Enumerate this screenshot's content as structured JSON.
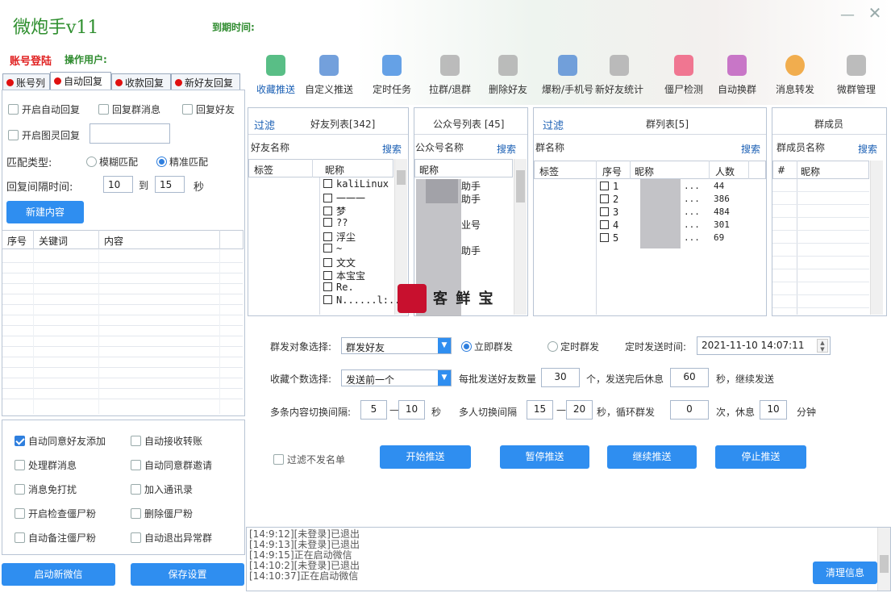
{
  "app": {
    "title": "微炮手v11",
    "expire_label": "到期时间:",
    "login_label": "账号登陆",
    "operator_label": "操作用户:",
    "min_glyph": "—",
    "close_glyph": "✕"
  },
  "toolbar": [
    {
      "label": "收藏推送",
      "icon": "bookmark-star-icon",
      "color": "#3cb371"
    },
    {
      "label": "自定义推送",
      "icon": "send-plane-icon",
      "color": "#5b8fd6"
    },
    {
      "label": "定时任务",
      "icon": "id-card-icon",
      "color": "#4a90e2"
    },
    {
      "label": "拉群/退群",
      "icon": "users-icon",
      "color": "#b0b0b0"
    },
    {
      "label": "删除好友",
      "icon": "remove-user-icon",
      "color": "#b0b0b0"
    },
    {
      "label": "爆粉/手机号",
      "icon": "contact-card-icon",
      "color": "#5b8fd6"
    },
    {
      "label": "新好友统计",
      "icon": "new-user-icon",
      "color": "#b0b0b0"
    },
    {
      "label": "僵尸检测",
      "icon": "zombie-face-icon",
      "color": "#f06080"
    },
    {
      "label": "自动换群",
      "icon": "document-icon",
      "color": "#c060c0"
    },
    {
      "label": "消息转发",
      "icon": "circles-icon",
      "color": "#f0a030"
    },
    {
      "label": "微群管理",
      "icon": "gear-icon",
      "color": "#b0b0b0"
    }
  ],
  "left_tabs": [
    "账号列",
    "自动回复",
    "收款回复",
    "新好友回复"
  ],
  "auto_reply": {
    "enable_auto": "开启自动回复",
    "reply_group": "回复群消息",
    "reply_friend": "回复好友",
    "enable_ghost": "开启图灵回复",
    "ghost_value": "",
    "match_type_label": "匹配类型:",
    "fuzzy": "模糊匹配",
    "exact": "精准匹配",
    "interval_label": "回复间隔时间:",
    "interval_from": "10",
    "to": "到",
    "interval_to": "15",
    "sec": "秒",
    "new_content": "新建内容",
    "columns": [
      "序号",
      "关键词",
      "内容"
    ]
  },
  "options": [
    {
      "label": "自动同意好友添加",
      "checked": true
    },
    {
      "label": "自动接收转账",
      "checked": false
    },
    {
      "label": "处理群消息",
      "checked": false
    },
    {
      "label": "自动同意群邀请",
      "checked": false
    },
    {
      "label": "消息免打扰",
      "checked": false
    },
    {
      "label": "加入通讯录",
      "checked": false
    },
    {
      "label": "开启检查僵尸粉",
      "checked": false
    },
    {
      "label": "删除僵尸粉",
      "checked": false
    },
    {
      "label": "自动备注僵尸粉",
      "checked": false
    },
    {
      "label": "自动退出异常群",
      "checked": false
    }
  ],
  "left_buttons": {
    "start_wechat": "启动新微信",
    "save": "保存设置"
  },
  "friends": {
    "filter": "过滤",
    "title": "好友列表[342]",
    "name_label": "好友名称",
    "search": "搜索",
    "col_tag": "标签",
    "col_nick": "昵称",
    "items": [
      "kaliLinux",
      "一一一",
      "梦",
      "??",
      "浮尘",
      "~",
      "文文",
      "本宝宝",
      "Re.",
      "N......l:..."
    ]
  },
  "official": {
    "title": "公众号列表 [45]",
    "name_label": "公众号名称",
    "search": "搜索",
    "col_nick": "昵称",
    "items": [
      "助手",
      "助手",
      "",
      "业号",
      "",
      "助手",
      "",
      "",
      ""
    ]
  },
  "groups": {
    "filter": "过滤",
    "title": "群列表[5]",
    "name_label": "群名称",
    "search": "搜索",
    "col_tag": "标签",
    "col_no": "序号",
    "col_nick": "昵称",
    "col_count": "人数",
    "rows": [
      {
        "no": "1",
        "name": "...",
        "count": "44"
      },
      {
        "no": "2",
        "name": "...",
        "count": "386"
      },
      {
        "no": "3",
        "name": "...",
        "count": "484"
      },
      {
        "no": "4",
        "name": "...",
        "count": "301"
      },
      {
        "no": "5",
        "name": "...",
        "count": "69"
      }
    ]
  },
  "members": {
    "title": "群成员",
    "name_label": "群成员名称",
    "search": "搜索",
    "col_hash": "#",
    "col_nick": "昵称"
  },
  "watermark": "客 鲜 宝",
  "send": {
    "target_label": "群发对象选择:",
    "target_value": "群发好友",
    "now": "立即群发",
    "timed": "定时群发",
    "time_label": "定时发送时间:",
    "time_value": "2021-11-10 14:07:11",
    "fav_label": "收藏个数选择:",
    "fav_value": "发送前一个",
    "batch_label": "每批发送好友数量",
    "batch_value": "30",
    "rest_label": "个，发送完后休息",
    "rest_value": "60",
    "rest_unit": "秒，继续发送",
    "multi_label": "多条内容切换间隔:",
    "multi_from": "5",
    "dash": "—",
    "multi_to": "10",
    "multi_unit": "秒",
    "person_label": "多人切换间隔",
    "person_from": "15",
    "person_to": "20",
    "loop_label": "秒，循环群发",
    "loop_value": "0",
    "loop_unit": "次，休息",
    "break_value": "10",
    "break_unit": "分钟",
    "filter_label": "过滤不发名单",
    "start": "开始推送",
    "pause": "暂停推送",
    "resume": "继续推送",
    "stop": "停止推送"
  },
  "log": {
    "lines": [
      "[14:9:12][未登录]已退出",
      "[14:9:13][未登录]已退出",
      "[14:9:15]正在启动微信",
      "[14:10:2][未登录]已退出",
      "[14:10:37]正在启动微信"
    ],
    "clear": "清理信息"
  }
}
